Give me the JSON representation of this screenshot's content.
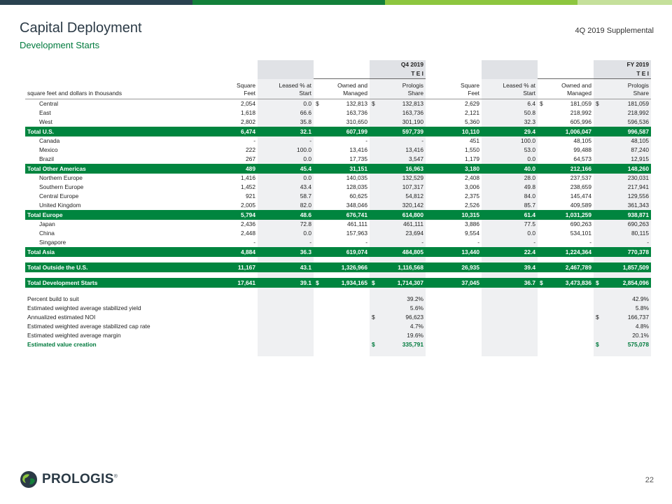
{
  "colors": {
    "green": "#00853f",
    "bar": [
      "#2a4250",
      "#13803a",
      "#8dc63f",
      "#c5e09b"
    ]
  },
  "header": {
    "title": "Capital Deployment",
    "subtitle": "Development Starts",
    "supplemental": "4Q 2019 Supplemental"
  },
  "table": {
    "q4_label": "Q4 2019",
    "fy_label": "FY 2019",
    "tei": "T E I",
    "unit_label": "square feet and dollars in thousands",
    "columns": {
      "sqft": [
        "Square",
        "Feet"
      ],
      "leased": [
        "Leased % at",
        "Start"
      ],
      "owned": [
        "Owned and",
        "Managed"
      ],
      "share": [
        "Prologis",
        "Share"
      ]
    },
    "dollar": "$",
    "sections": [
      {
        "rows": [
          {
            "label": "Central",
            "v": [
              "2,054",
              "0.0",
              "132,813",
              "132,813",
              "2,629",
              "6.4",
              "181,059",
              "181,059"
            ],
            "d": [
              0,
              0,
              1,
              1,
              0,
              0,
              1,
              1
            ]
          },
          {
            "label": "East",
            "v": [
              "1,618",
              "66.6",
              "163,736",
              "163,736",
              "2,121",
              "50.8",
              "218,992",
              "218,992"
            ]
          },
          {
            "label": "West",
            "v": [
              "2,802",
              "35.8",
              "310,650",
              "301,190",
              "5,360",
              "32.3",
              "605,996",
              "596,536"
            ]
          }
        ],
        "total": {
          "label": "Total U.S.",
          "v": [
            "6,474",
            "32.1",
            "607,199",
            "597,739",
            "10,110",
            "29.4",
            "1,006,047",
            "996,587"
          ]
        }
      },
      {
        "rows": [
          {
            "label": "Canada",
            "v": [
              "-",
              "-",
              "-",
              "-",
              "451",
              "100.0",
              "48,105",
              "48,105"
            ]
          },
          {
            "label": "Mexico",
            "v": [
              "222",
              "100.0",
              "13,416",
              "13,416",
              "1,550",
              "53.0",
              "99,488",
              "87,240"
            ]
          },
          {
            "label": "Brazil",
            "v": [
              "267",
              "0.0",
              "17,735",
              "3,547",
              "1,179",
              "0.0",
              "64,573",
              "12,915"
            ]
          }
        ],
        "total": {
          "label": "Total Other Americas",
          "v": [
            "489",
            "45.4",
            "31,151",
            "16,963",
            "3,180",
            "40.0",
            "212,166",
            "148,260"
          ]
        }
      },
      {
        "rows": [
          {
            "label": "Northern Europe",
            "v": [
              "1,416",
              "0.0",
              "140,035",
              "132,529",
              "2,408",
              "28.0",
              "237,537",
              "230,031"
            ]
          },
          {
            "label": "Southern Europe",
            "v": [
              "1,452",
              "43.4",
              "128,035",
              "107,317",
              "3,006",
              "49.8",
              "238,659",
              "217,941"
            ]
          },
          {
            "label": "Central Europe",
            "v": [
              "921",
              "58.7",
              "60,625",
              "54,812",
              "2,375",
              "84.0",
              "145,474",
              "129,556"
            ]
          },
          {
            "label": "United Kingdom",
            "v": [
              "2,005",
              "82.0",
              "348,046",
              "320,142",
              "2,526",
              "85.7",
              "409,589",
              "361,343"
            ]
          }
        ],
        "total": {
          "label": "Total Europe",
          "v": [
            "5,794",
            "48.6",
            "676,741",
            "614,800",
            "10,315",
            "61.4",
            "1,031,259",
            "938,871"
          ]
        }
      },
      {
        "rows": [
          {
            "label": "Japan",
            "v": [
              "2,436",
              "72.8",
              "461,111",
              "461,111",
              "3,886",
              "77.5",
              "690,263",
              "690,263"
            ]
          },
          {
            "label": "China",
            "v": [
              "2,448",
              "0.0",
              "157,963",
              "23,694",
              "9,554",
              "0.0",
              "534,101",
              "80,115"
            ]
          },
          {
            "label": "Singapore",
            "v": [
              "-",
              "-",
              "-",
              "-",
              "-",
              "-",
              "-",
              "-"
            ]
          }
        ],
        "total": {
          "label": "Total Asia",
          "v": [
            "4,884",
            "36.3",
            "619,074",
            "484,805",
            "13,440",
            "22.4",
            "1,224,364",
            "770,378"
          ]
        }
      }
    ],
    "outside": {
      "label": "Total Outside the U.S.",
      "v": [
        "11,167",
        "43.1",
        "1,326,966",
        "1,116,568",
        "26,935",
        "39.4",
        "2,467,789",
        "1,857,509"
      ]
    },
    "grand": {
      "label": "Total Development Starts",
      "v": [
        "17,641",
        "39.1",
        "1,934,165",
        "1,714,307",
        "37,045",
        "36.7",
        "3,473,836",
        "2,854,096"
      ]
    },
    "metrics": [
      {
        "label": "Percent build to suit",
        "q4": "39.2%",
        "fy": "42.9%"
      },
      {
        "label": "Estimated weighted average stabilized yield",
        "q4": "5.6%",
        "fy": "5.8%"
      },
      {
        "label": "Annualized estimated NOI",
        "q4": "96,623",
        "fy": "166,737",
        "dollar": true
      },
      {
        "label": "Estimated weighted average stabilized cap rate",
        "q4": "4.7%",
        "fy": "4.8%"
      },
      {
        "label": "Estimated weighted average margin",
        "q4": "19.6%",
        "fy": "20.1%"
      },
      {
        "label": "Estimated value creation",
        "q4": "335,791",
        "fy": "575,078",
        "dollar": true,
        "highlight": true
      }
    ]
  },
  "footer": {
    "logo_text": "PROLOGIS",
    "registered": "®",
    "page": "22"
  }
}
